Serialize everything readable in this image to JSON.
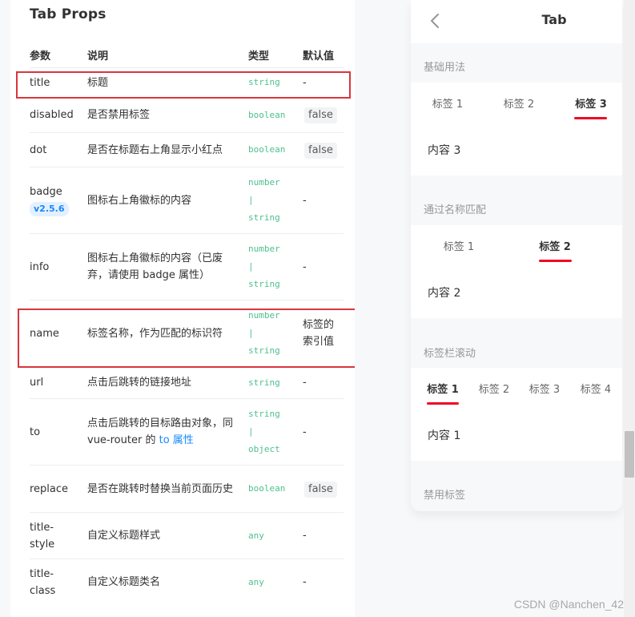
{
  "doc": {
    "title": "Tab Props",
    "headers": {
      "param": "参数",
      "desc": "说明",
      "type": "类型",
      "default": "默认值"
    },
    "rows": [
      {
        "param": "title",
        "desc": "标题",
        "type": "string",
        "default": "-"
      },
      {
        "param": "disabled",
        "desc": "是否禁用标签",
        "type": "boolean",
        "default": "false"
      },
      {
        "param": "dot",
        "desc": "是否在标题右上角显示小红点",
        "type": "boolean",
        "default": "false"
      },
      {
        "param": "badge",
        "badge": "v2.5.6",
        "desc": "图标右上角徽标的内容",
        "type1": "number",
        "type_sep": "|",
        "type2": "string",
        "default": "-"
      },
      {
        "param": "info",
        "desc": "图标右上角徽标的内容（已废弃，请使用 badge 属性）",
        "type1": "number",
        "type_sep": "|",
        "type2": "string",
        "default": "-"
      },
      {
        "param": "name",
        "desc": "标签名称，作为匹配的标识符",
        "type1": "number",
        "type_sep": "|",
        "type2": "string",
        "default": "标签的索引值"
      },
      {
        "param": "url",
        "desc": "点击后跳转的链接地址",
        "type": "string",
        "default": "-"
      },
      {
        "param": "to",
        "desc": "点击后跳转的目标路由对象，同 vue-router 的 ",
        "desc_link": "to 属性",
        "type1": "string",
        "type_sep": "|",
        "type2": "object",
        "default": "-"
      },
      {
        "param": "replace",
        "desc": "是否在跳转时替换当前页面历史",
        "type": "boolean",
        "default": "false"
      },
      {
        "param": "title-style",
        "desc": "自定义标题样式",
        "type": "any",
        "default": "-"
      },
      {
        "param": "title-class",
        "desc": "自定义标题类名",
        "type": "any",
        "default": "-"
      }
    ]
  },
  "demo": {
    "nav_title": "Tab",
    "groups": [
      {
        "title": "基础用法",
        "tabs": [
          "标签 1",
          "标签 2",
          "标签 3"
        ],
        "active": 2,
        "content": "内容 3"
      },
      {
        "title": "通过名称匹配",
        "tabs": [
          "标签 1",
          "标签 2"
        ],
        "active": 1,
        "content": "内容 2"
      },
      {
        "title": "标签栏滚动",
        "tabs": [
          "标签 1",
          "标签 2",
          "标签 3",
          "标签 4"
        ],
        "active": 0,
        "content": "内容 1"
      },
      {
        "title": "禁用标签"
      }
    ]
  },
  "colors": {
    "accent": "#ee0a24",
    "type_text": "#4fc08d",
    "highlight_box": "#d9363e",
    "link": "#1989fa"
  },
  "watermark": "CSDN @Nanchen_42"
}
